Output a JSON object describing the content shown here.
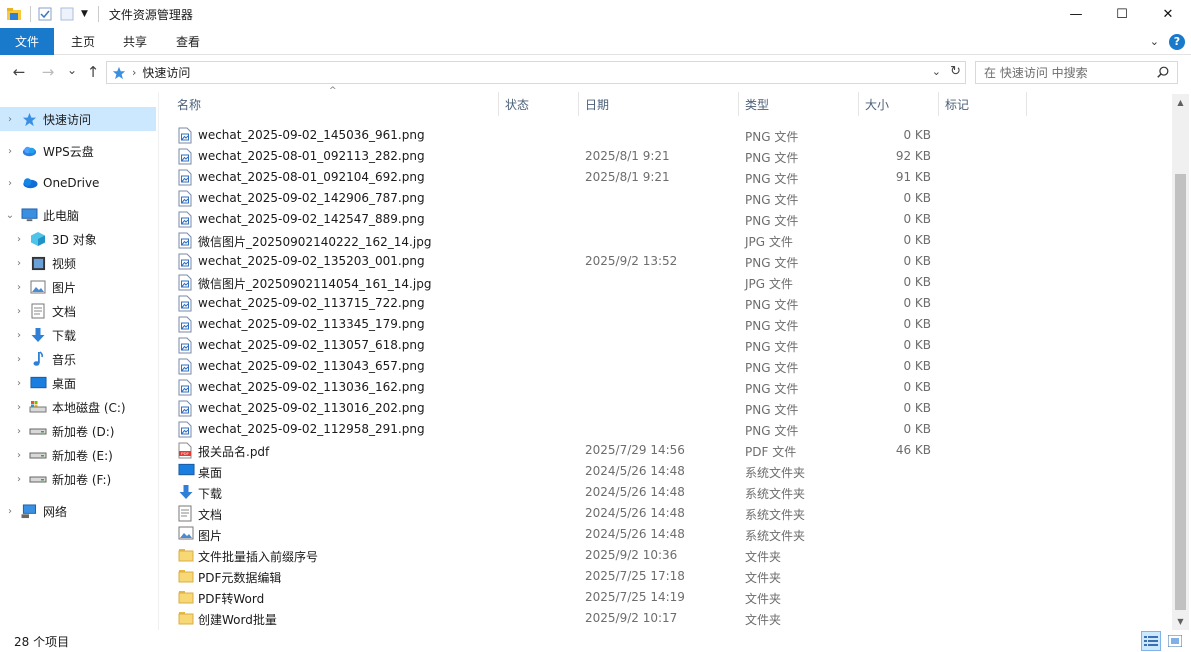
{
  "window": {
    "title": "文件资源管理器",
    "minimize": "—",
    "maximize": "☐",
    "close": "✕"
  },
  "ribbon": {
    "tabs": [
      "文件",
      "主页",
      "共享",
      "查看"
    ],
    "expand_icon": "chevron-down-icon",
    "help_icon": "?"
  },
  "nav": {
    "back": "←",
    "forward": "→",
    "recent": "⌄",
    "up": "↑",
    "breadcrumb": "快速访问",
    "search_placeholder": "在 快速访问 中搜索"
  },
  "sidebar": {
    "items": [
      {
        "label": "快速访问",
        "icon": "star-icon",
        "level": 0,
        "selected": true
      },
      {
        "label": "WPS云盘",
        "icon": "cloud-icon",
        "level": 0
      },
      {
        "label": "OneDrive",
        "icon": "onedrive-icon",
        "level": 0
      },
      {
        "label": "此电脑",
        "icon": "computer-icon",
        "level": 0,
        "expanded": true
      },
      {
        "label": "3D 对象",
        "icon": "3d-objects-icon",
        "level": 1
      },
      {
        "label": "视频",
        "icon": "video-icon",
        "level": 1
      },
      {
        "label": "图片",
        "icon": "pictures-icon",
        "level": 1
      },
      {
        "label": "文档",
        "icon": "documents-icon",
        "level": 1
      },
      {
        "label": "下载",
        "icon": "downloads-icon",
        "level": 1
      },
      {
        "label": "音乐",
        "icon": "music-icon",
        "level": 1
      },
      {
        "label": "桌面",
        "icon": "desktop-icon",
        "level": 1
      },
      {
        "label": "本地磁盘 (C:)",
        "icon": "system-drive-icon",
        "level": 1
      },
      {
        "label": "新加卷 (D:)",
        "icon": "drive-icon",
        "level": 1
      },
      {
        "label": "新加卷 (E:)",
        "icon": "drive-icon",
        "level": 1
      },
      {
        "label": "新加卷 (F:)",
        "icon": "drive-icon",
        "level": 1
      },
      {
        "label": "网络",
        "icon": "network-icon",
        "level": 0
      }
    ]
  },
  "columns": {
    "name": "名称",
    "status": "状态",
    "date": "日期",
    "type": "类型",
    "size": "大小",
    "tags": "标记"
  },
  "files": [
    {
      "name": "wechat_2025-09-02_145036_961.png",
      "date": "",
      "type": "PNG 文件",
      "size": "0 KB",
      "icon": "image-file-icon"
    },
    {
      "name": "wechat_2025-08-01_092113_282.png",
      "date": "2025/8/1 9:21",
      "type": "PNG 文件",
      "size": "92 KB",
      "icon": "image-file-icon"
    },
    {
      "name": "wechat_2025-08-01_092104_692.png",
      "date": "2025/8/1 9:21",
      "type": "PNG 文件",
      "size": "91 KB",
      "icon": "image-file-icon"
    },
    {
      "name": "wechat_2025-09-02_142906_787.png",
      "date": "",
      "type": "PNG 文件",
      "size": "0 KB",
      "icon": "image-file-icon"
    },
    {
      "name": "wechat_2025-09-02_142547_889.png",
      "date": "",
      "type": "PNG 文件",
      "size": "0 KB",
      "icon": "image-file-icon"
    },
    {
      "name": "微信图片_20250902140222_162_14.jpg",
      "date": "",
      "type": "JPG 文件",
      "size": "0 KB",
      "icon": "image-file-icon"
    },
    {
      "name": "wechat_2025-09-02_135203_001.png",
      "date": "2025/9/2 13:52",
      "type": "PNG 文件",
      "size": "0 KB",
      "icon": "image-file-icon"
    },
    {
      "name": "微信图片_20250902114054_161_14.jpg",
      "date": "",
      "type": "JPG 文件",
      "size": "0 KB",
      "icon": "image-file-icon"
    },
    {
      "name": "wechat_2025-09-02_113715_722.png",
      "date": "",
      "type": "PNG 文件",
      "size": "0 KB",
      "icon": "image-file-icon"
    },
    {
      "name": "wechat_2025-09-02_113345_179.png",
      "date": "",
      "type": "PNG 文件",
      "size": "0 KB",
      "icon": "image-file-icon"
    },
    {
      "name": "wechat_2025-09-02_113057_618.png",
      "date": "",
      "type": "PNG 文件",
      "size": "0 KB",
      "icon": "image-file-icon"
    },
    {
      "name": "wechat_2025-09-02_113043_657.png",
      "date": "",
      "type": "PNG 文件",
      "size": "0 KB",
      "icon": "image-file-icon"
    },
    {
      "name": "wechat_2025-09-02_113036_162.png",
      "date": "",
      "type": "PNG 文件",
      "size": "0 KB",
      "icon": "image-file-icon"
    },
    {
      "name": "wechat_2025-09-02_113016_202.png",
      "date": "",
      "type": "PNG 文件",
      "size": "0 KB",
      "icon": "image-file-icon"
    },
    {
      "name": "wechat_2025-09-02_112958_291.png",
      "date": "",
      "type": "PNG 文件",
      "size": "0 KB",
      "icon": "image-file-icon"
    },
    {
      "name": "报关品名.pdf",
      "date": "2025/7/29 14:56",
      "type": "PDF 文件",
      "size": "46 KB",
      "icon": "pdf-file-icon"
    },
    {
      "name": "桌面",
      "date": "2024/5/26 14:48",
      "type": "系统文件夹",
      "size": "",
      "icon": "desktop-folder-icon"
    },
    {
      "name": "下载",
      "date": "2024/5/26 14:48",
      "type": "系统文件夹",
      "size": "",
      "icon": "downloads-folder-icon"
    },
    {
      "name": "文档",
      "date": "2024/5/26 14:48",
      "type": "系统文件夹",
      "size": "",
      "icon": "documents-folder-icon"
    },
    {
      "name": "图片",
      "date": "2024/5/26 14:48",
      "type": "系统文件夹",
      "size": "",
      "icon": "pictures-folder-icon"
    },
    {
      "name": "文件批量插入前缀序号",
      "date": "2025/9/2 10:36",
      "type": "文件夹",
      "size": "",
      "icon": "folder-icon"
    },
    {
      "name": "PDF元数据编辑",
      "date": "2025/7/25 17:18",
      "type": "文件夹",
      "size": "",
      "icon": "folder-icon"
    },
    {
      "name": "PDF转Word",
      "date": "2025/7/25 14:19",
      "type": "文件夹",
      "size": "",
      "icon": "folder-icon"
    },
    {
      "name": "创建Word批量",
      "date": "2025/9/2 10:17",
      "type": "文件夹",
      "size": "",
      "icon": "folder-icon"
    }
  ],
  "status": {
    "item_count": "28 个项目"
  },
  "colors": {
    "accent": "#1979ca",
    "selection": "#cce8ff",
    "header_text": "#4c607a",
    "secondary_text": "#6d6d6d",
    "folder": "#f8d775"
  }
}
